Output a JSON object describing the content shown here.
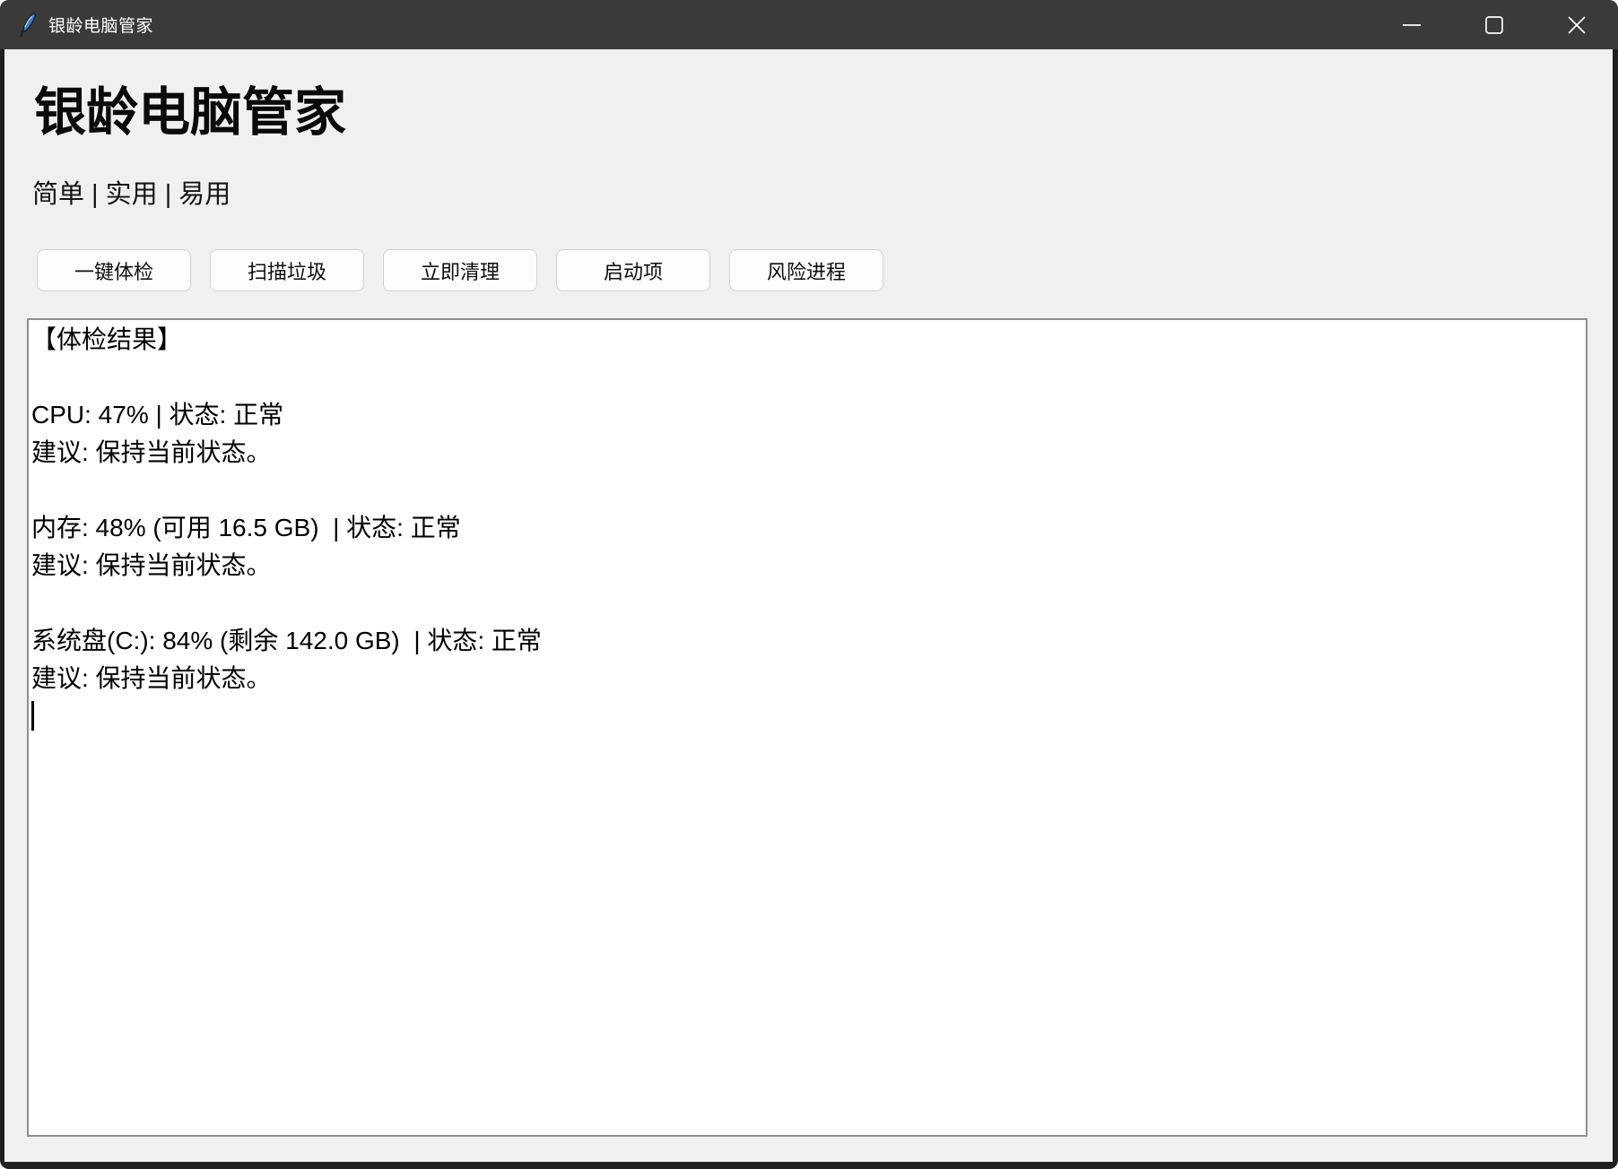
{
  "titlebar": {
    "title": "银龄电脑管家",
    "icons": {
      "app": "python-feather-icon",
      "minimize": "minimize-icon",
      "maximize": "maximize-icon",
      "close": "close-icon"
    }
  },
  "header": {
    "title": "银龄电脑管家",
    "tagline": "简单 | 实用 | 易用"
  },
  "toolbar": {
    "buttons": [
      "一键体检",
      "扫描垃圾",
      "立即清理",
      "启动项",
      "风险进程"
    ]
  },
  "results": {
    "lines": [
      "【体检结果】",
      "",
      "CPU: 47% | 状态: 正常",
      "建议: 保持当前状态。",
      "",
      "内存: 48% (可用 16.5 GB)  | 状态: 正常",
      "建议: 保持当前状态。",
      "",
      "系统盘(C:): 84% (剩余 142.0 GB)  | 状态: 正常",
      "建议: 保持当前状态。"
    ],
    "metrics": {
      "cpu_percent": 47,
      "cpu_status": "正常",
      "memory_percent": 48,
      "memory_available_gb": 16.5,
      "memory_status": "正常",
      "disk_c_percent": 84,
      "disk_c_free_gb": 142.0,
      "disk_c_status": "正常",
      "advice": "保持当前状态。"
    }
  },
  "colors": {
    "titlebar_bg": "#3b3a39",
    "window_border": "#201f1e",
    "content_bg": "#f0f0f0",
    "button_bg": "#fdfdfd",
    "button_border": "#d0d0d0",
    "textarea_bg": "#ffffff",
    "textarea_border": "#8f8f8f",
    "text": "#000000",
    "titlebar_text": "#ffffff",
    "icon_blue": "#3f7cbf"
  }
}
